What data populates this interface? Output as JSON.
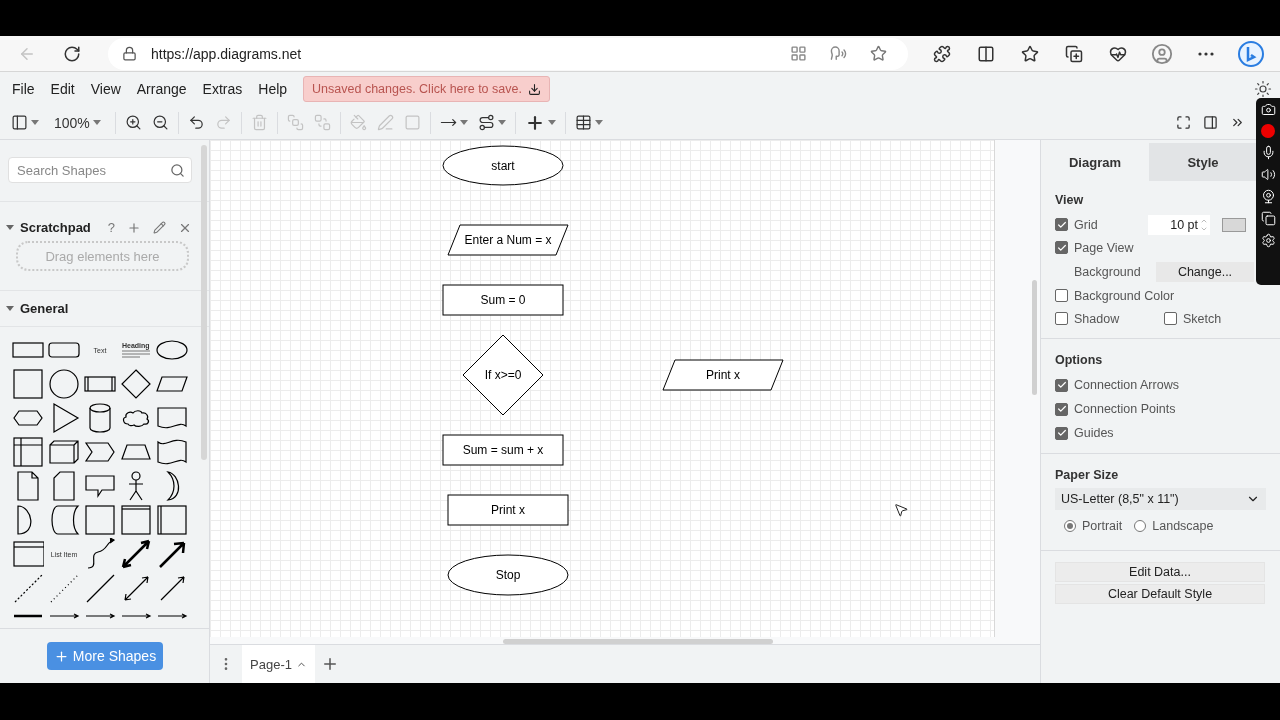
{
  "browser": {
    "url": "https://app.diagrams.net",
    "back_disabled": true
  },
  "menu": [
    "File",
    "Edit",
    "View",
    "Arrange",
    "Extras",
    "Help"
  ],
  "save_notice": "Unsaved changes. Click here to save.",
  "toolbar": [
    {
      "kind": "layout",
      "disabled": false,
      "dropdown": true
    },
    {
      "kind": "zoom",
      "label": "100%",
      "disabled": false,
      "dropdown": true
    },
    {
      "kind": "zoom-in",
      "disabled": false,
      "dropdown": false
    },
    {
      "kind": "zoom-out",
      "disabled": false,
      "dropdown": false
    },
    {
      "kind": "undo",
      "disabled": false,
      "dropdown": false
    },
    {
      "kind": "redo",
      "disabled": true,
      "dropdown": false
    },
    {
      "kind": "delete",
      "disabled": true,
      "dropdown": false
    },
    {
      "kind": "to-front",
      "disabled": true,
      "dropdown": false
    },
    {
      "kind": "to-back",
      "disabled": true,
      "dropdown": false
    },
    {
      "kind": "fill",
      "disabled": true,
      "dropdown": false
    },
    {
      "kind": "line-color",
      "disabled": true,
      "dropdown": false
    },
    {
      "kind": "shadow",
      "disabled": true,
      "dropdown": false
    },
    {
      "kind": "connection",
      "disabled": false,
      "dropdown": true
    },
    {
      "kind": "waypoints",
      "disabled": false,
      "dropdown": true
    },
    {
      "kind": "insert",
      "disabled": false,
      "dropdown": true
    },
    {
      "kind": "table",
      "disabled": false,
      "dropdown": true
    }
  ],
  "sidebar": {
    "search": {
      "placeholder": "Search Shapes"
    },
    "scratchpad": {
      "title": "Scratchpad",
      "expanded": true,
      "help": "?",
      "drop_hint": "Drag elements here"
    },
    "general": {
      "title": "General",
      "expanded": true,
      "shapes": [
        {
          "kind": "rectangle"
        },
        {
          "kind": "rounded-rectangle"
        },
        {
          "kind": "text",
          "label": "Text"
        },
        {
          "kind": "heading",
          "label": "Heading"
        },
        {
          "kind": "ellipse"
        },
        {
          "kind": "square"
        },
        {
          "kind": "circle"
        },
        {
          "kind": "process"
        },
        {
          "kind": "diamond"
        },
        {
          "kind": "parallelogram"
        },
        {
          "kind": "hexagon"
        },
        {
          "kind": "triangle"
        },
        {
          "kind": "cylinder"
        },
        {
          "kind": "cloud"
        },
        {
          "kind": "document"
        },
        {
          "kind": "internal-storage"
        },
        {
          "kind": "cube"
        },
        {
          "kind": "step"
        },
        {
          "kind": "trapezoid"
        },
        {
          "kind": "tape"
        },
        {
          "kind": "note"
        },
        {
          "kind": "card"
        },
        {
          "kind": "callout"
        },
        {
          "kind": "actor"
        },
        {
          "kind": "crescent"
        },
        {
          "kind": "half-circle"
        },
        {
          "kind": "data-storage"
        },
        {
          "kind": "container"
        },
        {
          "kind": "swimlane"
        },
        {
          "kind": "vertical-swimlane"
        },
        {
          "kind": "list"
        },
        {
          "kind": "list-item",
          "label": "List Item"
        },
        {
          "kind": "curved-arrow"
        },
        {
          "kind": "double-arrow"
        },
        {
          "kind": "arrow"
        },
        {
          "kind": "dashed-line"
        },
        {
          "kind": "dotted-line"
        },
        {
          "kind": "line"
        },
        {
          "kind": "bidirectional-line"
        },
        {
          "kind": "directional-line"
        },
        {
          "kind": "thick-line"
        },
        {
          "kind": "connector"
        },
        {
          "kind": "connector"
        },
        {
          "kind": "connector"
        },
        {
          "kind": "connector"
        }
      ]
    },
    "more_button": "More Shapes"
  },
  "canvas": {
    "nodes": [
      {
        "kind": "terminator",
        "label": "start"
      },
      {
        "kind": "data",
        "label": "Enter a Num = x"
      },
      {
        "kind": "process",
        "label": "Sum = 0"
      },
      {
        "kind": "decision",
        "label": "If x>=0"
      },
      {
        "kind": "data",
        "label": "Print x"
      },
      {
        "kind": "process",
        "label": "Sum = sum + x"
      },
      {
        "kind": "process",
        "label": "Print x"
      },
      {
        "kind": "terminator",
        "label": "Stop"
      }
    ]
  },
  "page_tabs": [
    {
      "label": "Page-1",
      "selected": true
    }
  ],
  "format_panel": {
    "tabs": [
      {
        "label": "Diagram",
        "selected": true
      },
      {
        "label": "Style",
        "selected": false
      }
    ],
    "view": {
      "title": "View",
      "grid": {
        "label": "Grid",
        "checked": true,
        "value": "10 pt"
      },
      "page_view": {
        "label": "Page View",
        "checked": true
      },
      "background": {
        "label": "Background",
        "button": "Change..."
      },
      "background_color": {
        "label": "Background Color",
        "checked": false
      },
      "shadow": {
        "label": "Shadow",
        "checked": false
      },
      "sketch": {
        "label": "Sketch",
        "checked": false
      }
    },
    "options": {
      "title": "Options",
      "items": [
        {
          "label": "Connection Arrows",
          "checked": true
        },
        {
          "label": "Connection Points",
          "checked": true
        },
        {
          "label": "Guides",
          "checked": true
        }
      ]
    },
    "paper": {
      "title": "Paper Size",
      "size": "US-Letter (8,5\" x 11\")",
      "orientations": [
        {
          "label": "Portrait",
          "selected": true
        },
        {
          "label": "Landscape",
          "selected": false
        }
      ]
    },
    "buttons": [
      "Edit Data...",
      "Clear Default Style"
    ]
  }
}
